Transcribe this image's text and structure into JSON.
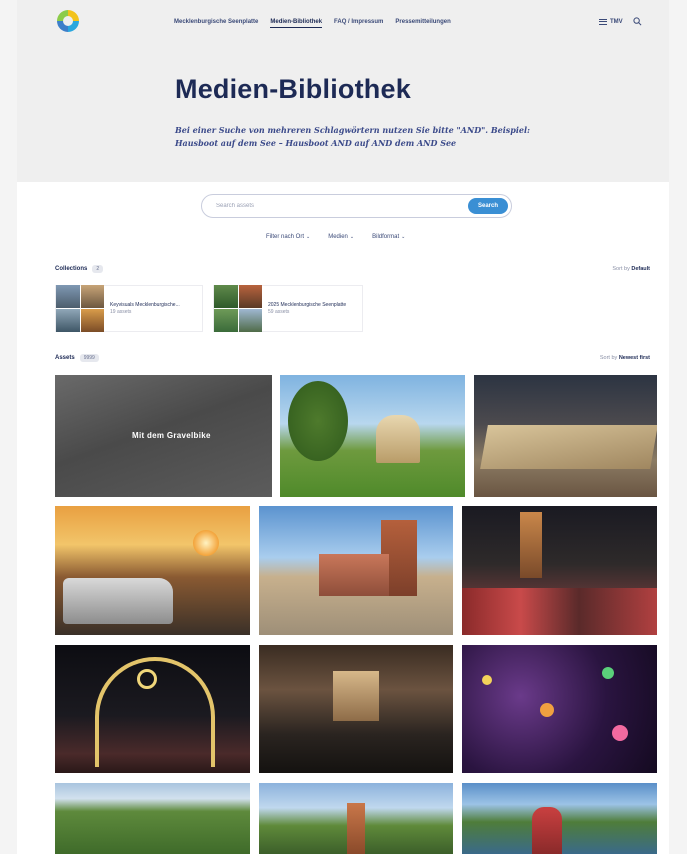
{
  "header": {
    "nav": [
      {
        "label": "Mecklenburgische Seenplatte",
        "active": false
      },
      {
        "label": "Medien-Bibliothek",
        "active": true
      },
      {
        "label": "FAQ / Impressum",
        "active": false
      },
      {
        "label": "Pressemitteilungen",
        "active": false
      }
    ],
    "menu_label": "TMV",
    "menu_icon": "hamburger-icon",
    "search_icon": "search-icon"
  },
  "hero": {
    "title": "Medien-Bibliothek",
    "subtitle": "Bei einer Suche von mehreren Schlagwörtern nutzen Sie bitte \"AND\". Beispiel: Hausboot auf dem See – Hausboot AND auf AND dem AND See"
  },
  "search": {
    "placeholder": "Search assets",
    "value": "",
    "button_label": "Search"
  },
  "filters": [
    {
      "label": "Filter nach Ort"
    },
    {
      "label": "Medien"
    },
    {
      "label": "Bildformat"
    }
  ],
  "collections": {
    "title": "Collections",
    "count": "2",
    "sort_label": "Sort by",
    "sort_value": "Default",
    "items": [
      {
        "name": "Keyvisuals Mecklenburgische...",
        "meta": "19 assets"
      },
      {
        "name": "2025 Mecklenburgische Seenplatte",
        "meta": "59 assets"
      }
    ]
  },
  "assets": {
    "title": "Assets",
    "count": "9999",
    "sort_label": "Sort by",
    "sort_value": "Newest first",
    "items": [
      {
        "name": "asset-gravelbike",
        "label": "Mit dem Gravelbike"
      },
      {
        "name": "asset-pavilion"
      },
      {
        "name": "asset-town-model"
      },
      {
        "name": "asset-houseboat-sunset"
      },
      {
        "name": "asset-harbour-town"
      },
      {
        "name": "asset-christmas-market-crowd"
      },
      {
        "name": "asset-light-arch"
      },
      {
        "name": "asset-concert-hall"
      },
      {
        "name": "asset-festival-lights"
      },
      {
        "name": "asset-palace-garden"
      },
      {
        "name": "asset-statue-cathedral"
      },
      {
        "name": "asset-lake-bike"
      }
    ]
  },
  "colors": {
    "accent": "#3a8fd4",
    "heading": "#1d2a55",
    "hero_bg": "#efefef"
  }
}
